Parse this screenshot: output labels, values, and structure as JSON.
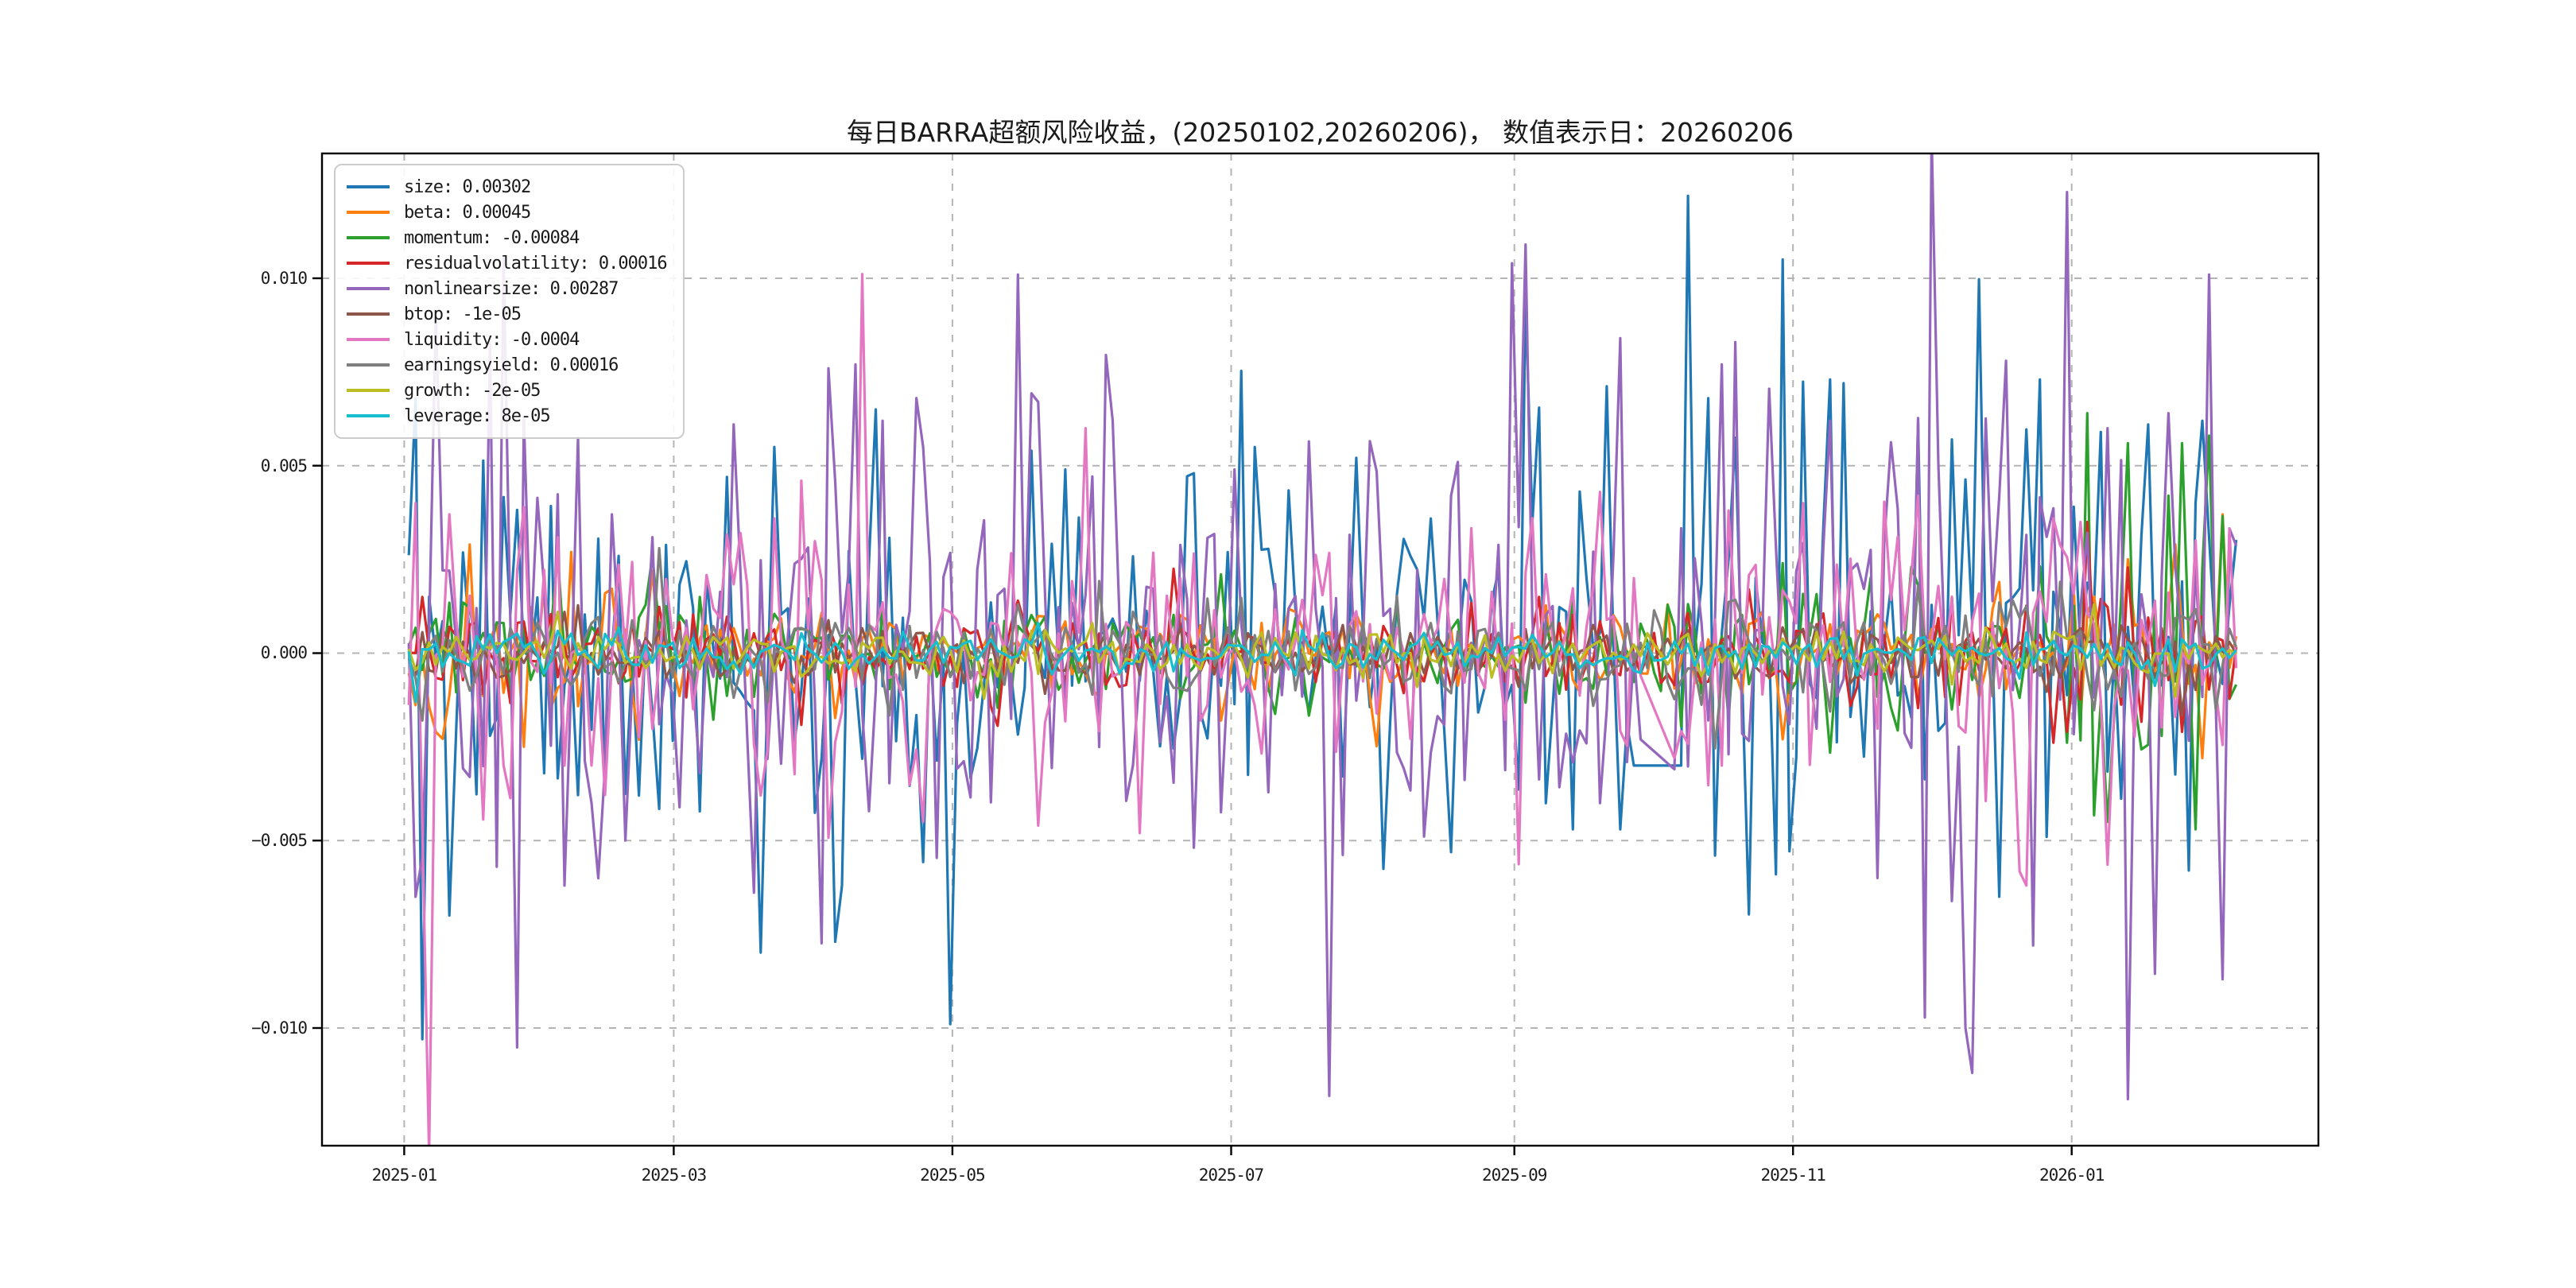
{
  "figure": {
    "background": "#ffffff",
    "spine_color": "#000000",
    "grid_color": "#b4b4b4",
    "text_color": "#1a1a1a"
  },
  "chart_data": {
    "type": "line",
    "title": "每日BARRA超额风险收益，(20250102,20260206)， 数值表示日：20260206",
    "xlabel": "",
    "ylabel": "",
    "grid": true,
    "legend_position": "upper left",
    "n_points": 271,
    "x_axis": {
      "pad_days": 18,
      "span_days": 437,
      "data_start_day": 1,
      "data_end_day": 401,
      "ticks": [
        {
          "label": "2025-01",
          "day": 0
        },
        {
          "label": "2025-03",
          "day": 59
        },
        {
          "label": "2025-05",
          "day": 120
        },
        {
          "label": "2025-07",
          "day": 181
        },
        {
          "label": "2025-09",
          "day": 243
        },
        {
          "label": "2025-11",
          "day": 304
        },
        {
          "label": "2026-01",
          "day": 365
        }
      ]
    },
    "y_axis": {
      "min": -0.01314,
      "max": 0.01333,
      "ticks": [
        {
          "label": "0.010",
          "v": 0.01
        },
        {
          "label": "0.005",
          "v": 0.005
        },
        {
          "label": "0.000",
          "v": 0.0
        },
        {
          "label": "−0.005",
          "v": -0.005
        },
        {
          "label": "−0.010",
          "v": -0.01
        }
      ]
    },
    "series": [
      {
        "name": "size",
        "legend_label": "size: 0.00302",
        "value": 0.00302,
        "color": "#1f77b4",
        "seed": 11,
        "std": 0.0021,
        "env": [
          1.4,
          1.2,
          1.0,
          1.2,
          1.0,
          0.9,
          0.95,
          1.0,
          1.1,
          1.2,
          1.25,
          1.1,
          1.1,
          1.0
        ],
        "flats": [
          [
            0.658,
            0.68,
            -0.003,
            -0.003
          ]
        ],
        "spikes": [
          [
            0.046,
            0.0068
          ],
          [
            0.049,
            -0.0103
          ],
          [
            0.064,
            -0.007
          ],
          [
            0.143,
            -0.0036
          ],
          [
            0.159,
            -0.0038
          ],
          [
            0.202,
            0.0047
          ],
          [
            0.225,
            0.0055
          ],
          [
            0.256,
            -0.0077
          ],
          [
            0.277,
            0.0065
          ],
          [
            0.313,
            -0.0099
          ],
          [
            0.356,
            0.0054
          ],
          [
            0.374,
            0.0049
          ],
          [
            0.436,
            0.0048
          ],
          [
            0.468,
            0.0055
          ],
          [
            0.604,
            0.0095
          ],
          [
            0.625,
            -0.0047
          ],
          [
            0.65,
            -0.0047
          ],
          [
            0.684,
            0.0122
          ],
          [
            0.693,
            0.0068
          ],
          [
            0.697,
            -0.0054
          ],
          [
            0.727,
            -0.0059
          ],
          [
            0.731,
            0.0105
          ],
          [
            0.757,
            0.0073
          ],
          [
            0.763,
            0.0072
          ],
          [
            0.8,
            0.0062
          ],
          [
            0.815,
            0.0057
          ],
          [
            0.84,
            -0.0065
          ],
          [
            0.86,
            0.0073
          ],
          [
            0.89,
            0.0059
          ],
          [
            0.916,
            0.0061
          ],
          [
            0.936,
            -0.0058
          ],
          [
            0.941,
            0.0062
          ],
          [
            1.0,
            0.00302
          ]
        ]
      },
      {
        "name": "beta",
        "legend_label": "beta: 0.00045",
        "value": 0.00045,
        "color": "#ff7f0e",
        "seed": 22,
        "std": 0.00065,
        "env": [
          1.3,
          1.8,
          1.1,
          0.9,
          0.9,
          0.8,
          0.8,
          0.9,
          1.0,
          0.9,
          0.9,
          0.9,
          1.1,
          1.5
        ],
        "spikes": [
          [
            0.058,
            -0.0021
          ],
          [
            0.075,
            0.0029
          ],
          [
            0.102,
            -0.0025
          ],
          [
            0.125,
            0.0027
          ],
          [
            0.165,
            0.0022
          ],
          [
            0.45,
            -0.0018
          ],
          [
            0.73,
            -0.0023
          ],
          [
            0.905,
            0.0025
          ],
          [
            0.928,
            0.0029
          ],
          [
            0.942,
            -0.0028
          ],
          [
            0.952,
            0.0037
          ],
          [
            1.0,
            0.00045
          ]
        ]
      },
      {
        "name": "momentum",
        "legend_label": "momentum: -0.00084",
        "value": -0.00084,
        "color": "#2ca02c",
        "seed": 33,
        "std": 0.00075,
        "env": [
          0.9,
          1.0,
          0.9,
          0.9,
          0.8,
          0.8,
          0.8,
          0.9,
          1.0,
          1.0,
          1.1,
          1.2,
          2.0,
          2.4
        ],
        "spikes": [
          [
            0.118,
            0.0026
          ],
          [
            0.167,
            0.0026
          ],
          [
            0.45,
            0.0021
          ],
          [
            0.73,
            0.0024
          ],
          [
            0.883,
            0.0064
          ],
          [
            0.893,
            -0.0045
          ],
          [
            0.906,
            0.0056
          ],
          [
            0.924,
            0.0042
          ],
          [
            0.93,
            0.0056
          ],
          [
            0.938,
            -0.0047
          ],
          [
            0.946,
            0.0058
          ],
          [
            1.0,
            -0.00084
          ]
        ]
      },
      {
        "name": "residualvolatility",
        "legend_label": "residualvolatility: 0.00016",
        "value": 0.00016,
        "color": "#d62728",
        "seed": 44,
        "std": 0.00062,
        "env": [
          1.0,
          1.1,
          1.0,
          0.9,
          0.9,
          0.8,
          0.8,
          0.9,
          0.9,
          1.0,
          1.1,
          1.2,
          1.3,
          1.3
        ],
        "spikes": [
          [
            0.05,
            0.0015
          ],
          [
            0.35,
            0.0014
          ],
          [
            0.61,
            0.0015
          ],
          [
            0.873,
            -0.0021
          ],
          [
            0.885,
            0.0035
          ],
          [
            0.93,
            -0.0021
          ],
          [
            1.0,
            0.00016
          ]
        ]
      },
      {
        "name": "nonlinearsize",
        "legend_label": "nonlinearsize: 0.00287",
        "value": 0.00287,
        "color": "#9467bd",
        "seed": 55,
        "std": 0.0026,
        "env": [
          1.2,
          1.2,
          1.0,
          1.0,
          1.2,
          0.9,
          1.0,
          1.0,
          1.0,
          1.1,
          1.1,
          1.3,
          1.4,
          1.2
        ],
        "flats": [
          [
            0.659,
            0.679,
            -0.0023,
            -0.0031
          ]
        ],
        "spikes": [
          [
            0.0455,
            -0.0065
          ],
          [
            0.057,
            0.0091
          ],
          [
            0.088,
            -0.0057
          ],
          [
            0.1,
            0.0063
          ],
          [
            0.12,
            -0.0062
          ],
          [
            0.153,
            -0.005
          ],
          [
            0.19,
            -0.0032
          ],
          [
            0.206,
            0.0061
          ],
          [
            0.253,
            0.0076
          ],
          [
            0.268,
            0.0077
          ],
          [
            0.282,
            0.0062
          ],
          [
            0.3,
            0.0055
          ],
          [
            0.348,
            0.0101
          ],
          [
            0.359,
            0.0067
          ],
          [
            0.397,
            0.0062
          ],
          [
            0.457,
            0.0049
          ],
          [
            0.566,
            0.0042
          ],
          [
            0.57,
            0.0051
          ],
          [
            0.597,
            0.0104
          ],
          [
            0.602,
            0.0109
          ],
          [
            0.64,
            -0.004
          ],
          [
            0.652,
            0.0084
          ],
          [
            0.7,
            0.0077
          ],
          [
            0.709,
            0.0083
          ],
          [
            0.755,
            0.0062
          ],
          [
            0.78,
            -0.006
          ],
          [
            0.822,
            -0.01
          ],
          [
            0.828,
            -0.0112
          ],
          [
            0.842,
            0.0078
          ],
          [
            0.856,
            -0.0078
          ],
          [
            0.874,
            0.0123
          ],
          [
            0.895,
            0.006
          ],
          [
            0.905,
            -0.0119
          ],
          [
            0.925,
            0.0064
          ],
          [
            0.9455,
            0.0101
          ],
          [
            0.951,
            -0.0087
          ],
          [
            1.0,
            0.00287
          ]
        ]
      },
      {
        "name": "btop",
        "legend_label": "btop: -1e-05",
        "value": -1e-05,
        "color": "#8c564b",
        "seed": 66,
        "std": 0.00035,
        "env": [
          1,
          1,
          1,
          1,
          1,
          1,
          1,
          1,
          1,
          1,
          1,
          1,
          1.2,
          1.2
        ],
        "spikes": [
          [
            0.12,
            0.0011
          ],
          [
            0.6,
            -0.0009
          ],
          [
            1.0,
            -1e-05
          ]
        ]
      },
      {
        "name": "liquidity",
        "legend_label": "liquidity: -0.0004",
        "value": -0.0004,
        "color": "#e377c2",
        "seed": 77,
        "std": 0.0015,
        "env": [
          1.6,
          1.3,
          1.1,
          1.1,
          1.1,
          0.9,
          0.9,
          1.0,
          1.0,
          1.0,
          1.1,
          1.2,
          1.0,
          0.9
        ],
        "flats": [
          [
            0.659,
            0.676,
            -0.0006,
            -0.0028
          ]
        ],
        "spikes": [
          [
            0.048,
            0.004
          ],
          [
            0.064,
            0.0037
          ],
          [
            0.09,
            -0.003
          ],
          [
            0.102,
            0.0039
          ],
          [
            0.122,
            -0.003
          ],
          [
            0.24,
            0.0046
          ],
          [
            0.3,
            -0.0045
          ],
          [
            0.36,
            -0.0046
          ],
          [
            0.384,
            0.006
          ],
          [
            0.41,
            -0.0048
          ],
          [
            0.605,
            0.0036
          ],
          [
            0.64,
            0.0043
          ],
          [
            0.7,
            -0.003
          ],
          [
            0.742,
            0.004
          ],
          [
            0.8,
            0.0042
          ],
          [
            0.855,
            -0.0062
          ],
          [
            0.88,
            0.0035
          ],
          [
            0.94,
            0.003
          ],
          [
            1.0,
            -0.0004
          ]
        ]
      },
      {
        "name": "earningsyield",
        "legend_label": "earningsyield: 0.00016",
        "value": 0.00016,
        "color": "#7f7f7f",
        "seed": 88,
        "std": 0.00058,
        "env": [
          1.2,
          1.2,
          1.0,
          0.9,
          0.9,
          0.9,
          0.9,
          1.0,
          1.0,
          1.0,
          1.0,
          1.0,
          1.2,
          1.3
        ],
        "spikes": [
          [
            0.05,
            -0.0018
          ],
          [
            0.168,
            0.0028
          ],
          [
            0.35,
            0.0013
          ],
          [
            0.8,
            0.0018
          ],
          [
            0.87,
            0.0019
          ],
          [
            0.95,
            -0.0015
          ],
          [
            1.0,
            0.00016
          ]
        ]
      },
      {
        "name": "growth",
        "legend_label": "growth: -2e-05",
        "value": -2e-05,
        "color": "#bcbd22",
        "seed": 99,
        "std": 0.0003,
        "env": [
          1,
          1,
          1,
          1,
          1,
          1,
          1,
          1,
          1,
          1,
          1,
          1,
          1.1,
          1.1
        ],
        "spikes": [
          [
            0.118,
            0.0011
          ],
          [
            0.55,
            -0.0009
          ],
          [
            1.0,
            -2e-05
          ]
        ]
      },
      {
        "name": "leverage",
        "legend_label": "leverage: 8e-05",
        "value": 8e-05,
        "color": "#17becf",
        "seed": 110,
        "std": 0.00026,
        "env": [
          1.2,
          1,
          1,
          1,
          0.9,
          0.9,
          0.9,
          0.9,
          1,
          1,
          1,
          1,
          1,
          1
        ],
        "spikes": [
          [
            0.046,
            -0.0013
          ],
          [
            0.36,
            0.0008
          ],
          [
            1.0,
            8e-05
          ]
        ]
      }
    ]
  }
}
